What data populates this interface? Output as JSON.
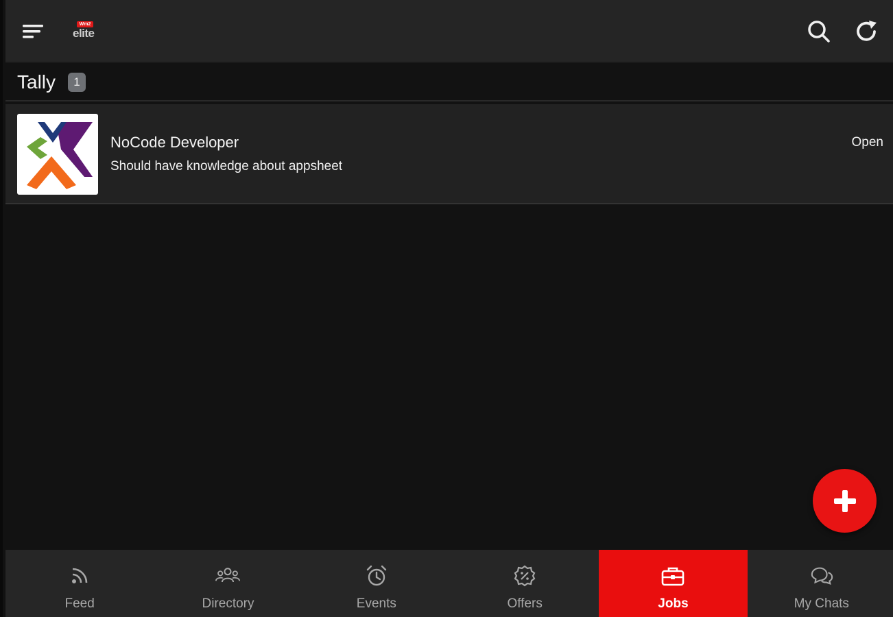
{
  "app": {
    "logo_badge": "Wm2",
    "logo_text": "elite"
  },
  "group": {
    "title": "Tally",
    "count": "1"
  },
  "jobs": [
    {
      "title": "NoCode Developer",
      "description": "Should have knowledge about appsheet",
      "status": "Open"
    }
  ],
  "nav": {
    "items": [
      {
        "label": "Feed",
        "icon": "rss-icon"
      },
      {
        "label": "Directory",
        "icon": "people-icon"
      },
      {
        "label": "Events",
        "icon": "alarm-clock-icon"
      },
      {
        "label": "Offers",
        "icon": "discount-badge-icon"
      },
      {
        "label": "Jobs",
        "icon": "briefcase-icon",
        "active": true
      },
      {
        "label": "My Chats",
        "icon": "chat-bubbles-icon"
      }
    ]
  },
  "colors": {
    "accent": "#e90e0e",
    "topbar": "#252525",
    "background": "#121212",
    "row": "#222222",
    "badge": "#6e7175"
  }
}
